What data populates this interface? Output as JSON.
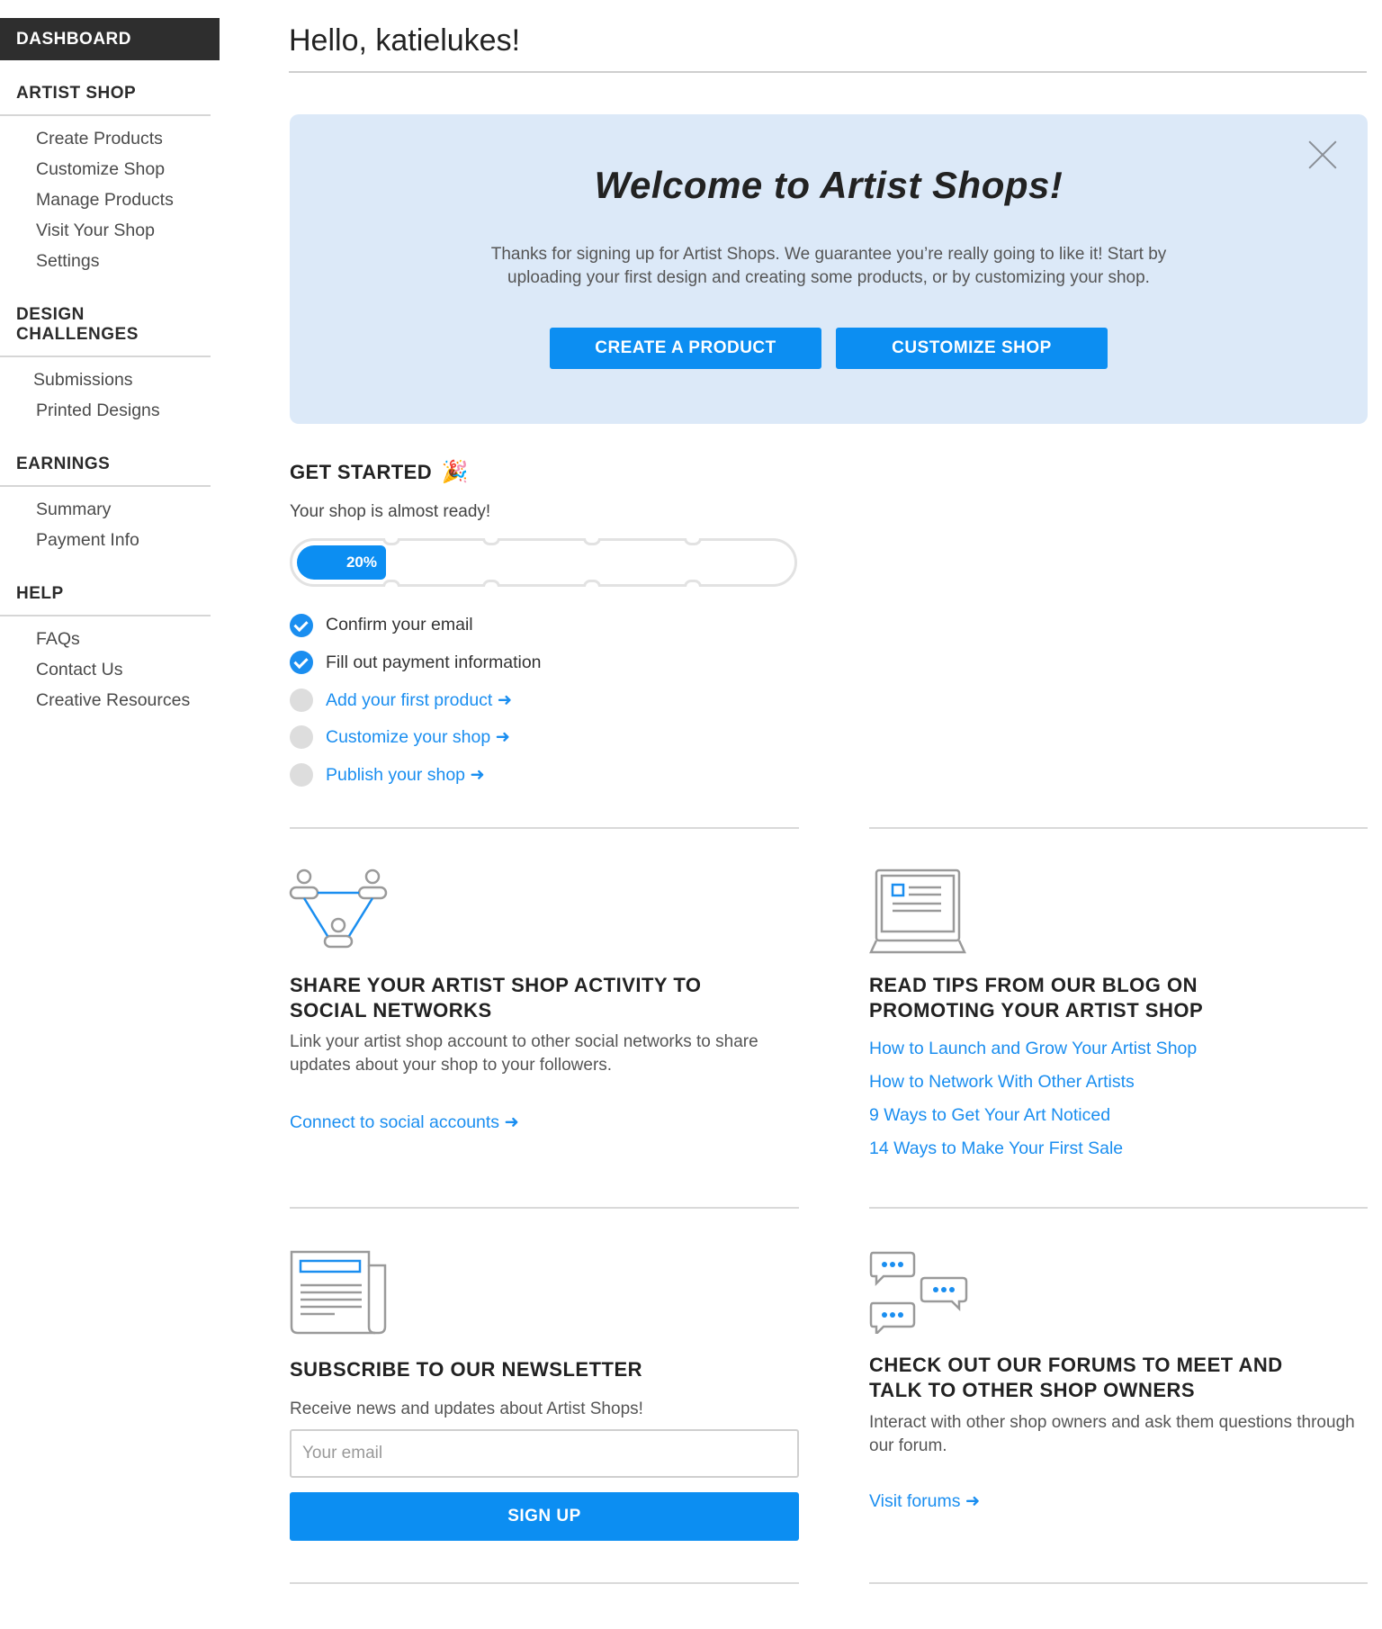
{
  "sidebar": {
    "dashboard": "DASHBOARD",
    "sections": [
      {
        "title": "ARTIST SHOP",
        "items": [
          "Create Products",
          "Customize Shop",
          "Manage Products",
          "Visit Your Shop",
          "Settings"
        ]
      },
      {
        "title": "DESIGN CHALLENGES",
        "items": [
          "Submissions",
          "Printed Designs"
        ]
      },
      {
        "title": "EARNINGS",
        "items": [
          "Summary",
          "Payment Info"
        ]
      },
      {
        "title": "HELP",
        "items": [
          "FAQs",
          "Contact Us",
          "Creative Resources"
        ]
      }
    ]
  },
  "greeting": "Hello, katielukes!",
  "welcome": {
    "title": "Welcome to Artist Shops!",
    "text": "Thanks for signing up for Artist Shops. We guarantee you’re really going to like it! Start by uploading your first design and creating some products, or by customizing your shop.",
    "create_button": "CREATE A PRODUCT",
    "customize_button": "CUSTOMIZE SHOP"
  },
  "get_started": {
    "title": "GET STARTED",
    "subtitle": "Your shop is almost ready!",
    "progress_label": "20%",
    "progress_value": 0.2,
    "items": [
      {
        "label": "Confirm your email",
        "done": true
      },
      {
        "label": "Fill out payment information",
        "done": true
      },
      {
        "label": "Add your first product ➜",
        "done": false
      },
      {
        "label": "Customize your shop ➜",
        "done": false
      },
      {
        "label": "Publish your shop ➜",
        "done": false
      }
    ]
  },
  "social": {
    "title_line1": "SHARE YOUR ARTIST SHOP ACTIVITY TO",
    "title_line2": "SOCIAL NETWORKS",
    "text": "Link your artist shop account to other social networks to share updates about your shop to your followers.",
    "link": "Connect to social accounts ➜"
  },
  "blog": {
    "title_line1": "READ TIPS FROM OUR BLOG ON",
    "title_line2": "PROMOTING YOUR ARTIST SHOP",
    "links": [
      "How to Launch and Grow Your Artist Shop",
      "How to Network With Other Artists",
      "9 Ways to Get Your Art Noticed",
      "14 Ways to Make Your First Sale"
    ]
  },
  "newsletter": {
    "title": "SUBSCRIBE TO OUR NEWSLETTER",
    "text": "Receive news and updates about Artist Shops!",
    "placeholder": "Your email",
    "button": "SIGN UP"
  },
  "forums": {
    "title_line1": "CHECK OUT OUR FORUMS TO MEET AND",
    "title_line2": "TALK TO OTHER SHOP OWNERS",
    "text": "Interact with other shop owners and ask them questions through our forum.",
    "link": "Visit forums ➜"
  },
  "colors": {
    "accent": "#0c8ef2",
    "welcome_bg": "#dce9f8",
    "sidebar_active": "#2e2e2e"
  }
}
